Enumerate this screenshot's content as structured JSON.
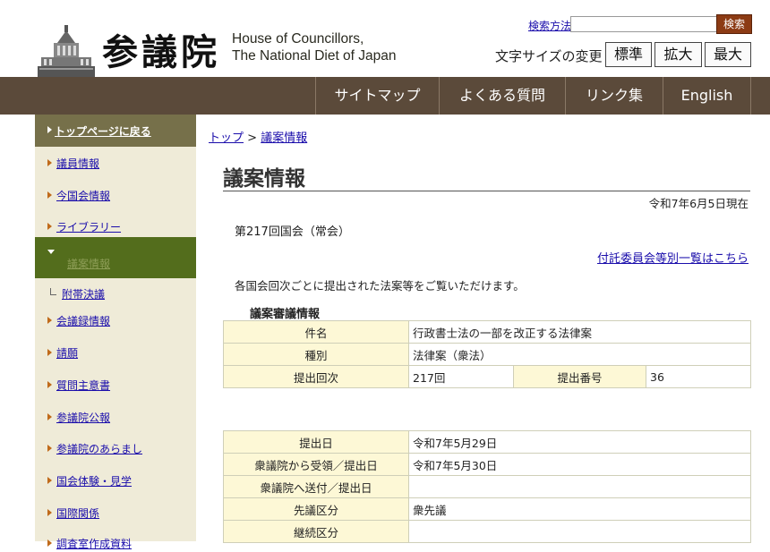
{
  "header": {
    "logo_kanji": "参議院",
    "logo_en_line1": "House of Councillors,",
    "logo_en_line2": "The National Diet of Japan",
    "search_link": "検索方法",
    "search_value": "",
    "search_button": "検索",
    "fontsize_label": "文字サイズの変更",
    "fontsize_buttons": [
      "標準",
      "拡大",
      "最大"
    ]
  },
  "nav": [
    "サイトマップ",
    "よくある質問",
    "リンク集",
    "English"
  ],
  "sidebar": {
    "top": "トップページに戻る",
    "items": [
      "議員情報",
      "今国会情報",
      "ライブラリー"
    ],
    "active": "議案情報",
    "sub": "附帯決議",
    "items_after": [
      "会議録情報",
      "請願",
      "質問主意書",
      "参議院公報",
      "参議院のあらまし",
      "国会体験・見学",
      "国際関係",
      "調査室作成資料"
    ]
  },
  "breadcrumb": {
    "home": "トップ",
    "sep": " > ",
    "current": "議案情報"
  },
  "main": {
    "title": "議案情報",
    "date_note": "令和7年6月5日現在",
    "session": "第217回国会（常会）",
    "committee_link": "付託委員会等別一覧はこちら",
    "intro": "各国会回次ごとに提出された法案等をご覧いただけます。",
    "section_head": "議案審議情報"
  },
  "table1": {
    "rows": [
      {
        "label": "件名",
        "value": "行政書士法の一部を改正する法律案"
      },
      {
        "label": "種別",
        "value": "法律案（衆法）"
      }
    ],
    "row3": {
      "label1": "提出回次",
      "value1": "217回",
      "label2": "提出番号",
      "value2": "36"
    }
  },
  "table2": {
    "rows": [
      {
        "label": "提出日",
        "value": "令和7年5月29日"
      },
      {
        "label": "衆議院から受領／提出日",
        "value": "令和7年5月30日"
      },
      {
        "label": "衆議院へ送付／提出日",
        "value": ""
      },
      {
        "label": "先議区分",
        "value": "衆先議"
      },
      {
        "label": "継続区分",
        "value": ""
      }
    ]
  }
}
